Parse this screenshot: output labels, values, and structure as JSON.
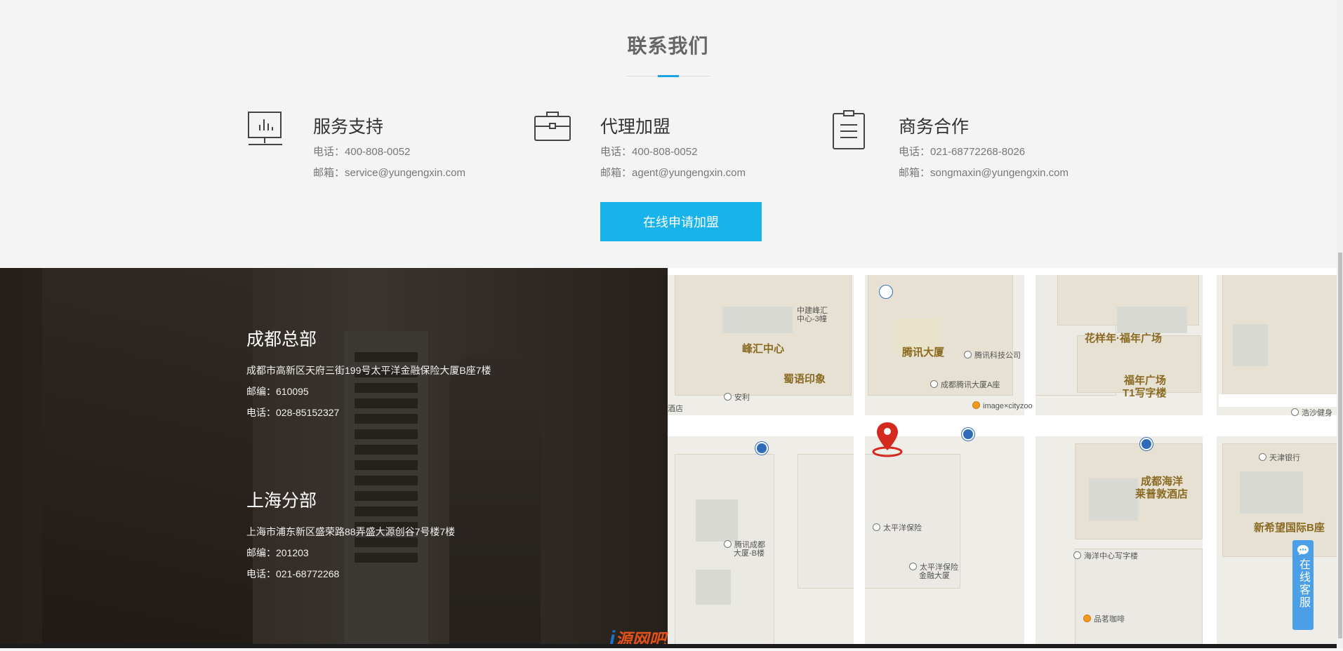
{
  "contact": {
    "title": "联系我们",
    "cards": [
      {
        "icon": "monitor-chart-icon",
        "title": "服务支持",
        "phone_label": "电话：",
        "phone": "400-808-0052",
        "email_label": "邮箱：",
        "email": "service@yungengxin.com"
      },
      {
        "icon": "briefcase-icon",
        "title": "代理加盟",
        "phone_label": "电话：",
        "phone": "400-808-0052",
        "email_label": "邮箱：",
        "email": "agent@yungengxin.com"
      },
      {
        "icon": "clipboard-icon",
        "title": "商务合作",
        "phone_label": "电话：",
        "phone": "021-68772268-8026",
        "email_label": "邮箱：",
        "email": "songmaxin@yungengxin.com"
      }
    ],
    "apply_button": "在线申请加盟"
  },
  "offices": [
    {
      "name": "成都总部",
      "address": "成都市高新区天府三街199号太平洋金融保险大厦B座7楼",
      "zip_label": "邮编：",
      "zip": "610095",
      "phone_label": "电话：",
      "phone": "028-85152327"
    },
    {
      "name": "上海分部",
      "address": "上海市浦东新区盛荣路88弄盛大源创谷7号楼7楼",
      "zip_label": "邮编：",
      "zip": "201203",
      "phone_label": "电话：",
      "phone": "021-68772268"
    }
  ],
  "map": {
    "labels": [
      "峰汇中心",
      "蜀语印象",
      "腾讯大厦",
      "花样年·福年广场",
      "福年广场",
      "T1写字楼",
      "成都海洋",
      "莱普敦酒店",
      "新希望国际B座"
    ],
    "pois": [
      "中建峰汇",
      "中心-3幢",
      "腾讯科技公司",
      "成都腾讯大厦A座",
      "image×cityzoo",
      "安利",
      "酒店",
      "浩沙健身",
      "天津银行",
      "太平洋保险",
      "腾讯成都",
      "大厦-B楼",
      "太平洋保险",
      "金融大厦",
      "海洋中心写字楼",
      "品茗咖啡"
    ]
  },
  "widgets": {
    "kefu": "在线客服",
    "watermark_prefix": "i",
    "watermark_text": "源网吧"
  },
  "colors": {
    "accent": "#19b3eb",
    "kefu": "#4a9fe6",
    "map_label": "#8a6a22",
    "pin": "#d42a1f"
  }
}
